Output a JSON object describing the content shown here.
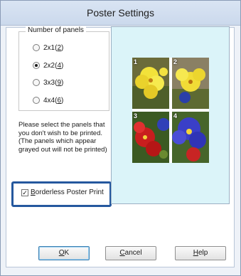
{
  "window": {
    "title": "Poster Settings"
  },
  "panels": {
    "label": "Number of panels",
    "options": [
      {
        "label": "2x1(",
        "key": "2",
        "suffix": ")",
        "checked": false
      },
      {
        "label": "2x2(",
        "key": "4",
        "suffix": ")",
        "checked": true
      },
      {
        "label": "3x3(",
        "key": "9",
        "suffix": ")",
        "checked": false
      },
      {
        "label": "4x4(",
        "key": "6",
        "suffix": ")",
        "checked": false
      }
    ]
  },
  "instructions": "Please select the panels that you don't wish to be printed. (The panels which appear grayed out will not be printed)",
  "borderless": {
    "label_key": "B",
    "label_rest": "orderless Poster Print",
    "checked": true
  },
  "preview": {
    "tiles": [
      "1",
      "2",
      "3",
      "4"
    ]
  },
  "buttons": {
    "ok_key": "O",
    "ok_rest": "K",
    "cancel_key": "C",
    "cancel_rest": "ancel",
    "help_key": "H",
    "help_rest": "elp"
  },
  "colors": {
    "highlight": "#25589e",
    "preview_bg": "#dbf4f9",
    "titlebar": "#cbd9ec"
  }
}
